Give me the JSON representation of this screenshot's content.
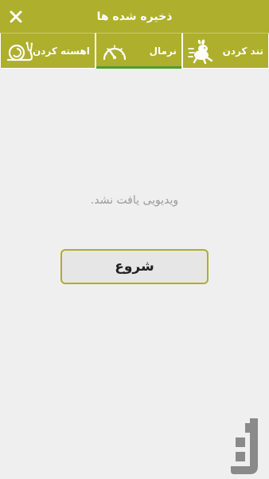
{
  "header": {
    "title": "ذخیره شده ها",
    "close_icon": "close-icon"
  },
  "tabs": [
    {
      "label": "تند کردن",
      "icon": "running-rabbit-icon",
      "active": false
    },
    {
      "label": "نرمال",
      "icon": "speedometer-icon",
      "active": true
    },
    {
      "label": "اهسته کردن",
      "icon": "snail-icon",
      "active": false
    }
  ],
  "main": {
    "empty_message": "ویدیویی یافت نشد.",
    "start_button_label": "شروع"
  },
  "colors": {
    "accent": "#aeaf2c",
    "active_tab_indicator": "#4aa02e",
    "background": "#efefef",
    "empty_text": "#9a9a9a"
  },
  "watermark": {
    "icon": "bazaar-logo-icon"
  }
}
